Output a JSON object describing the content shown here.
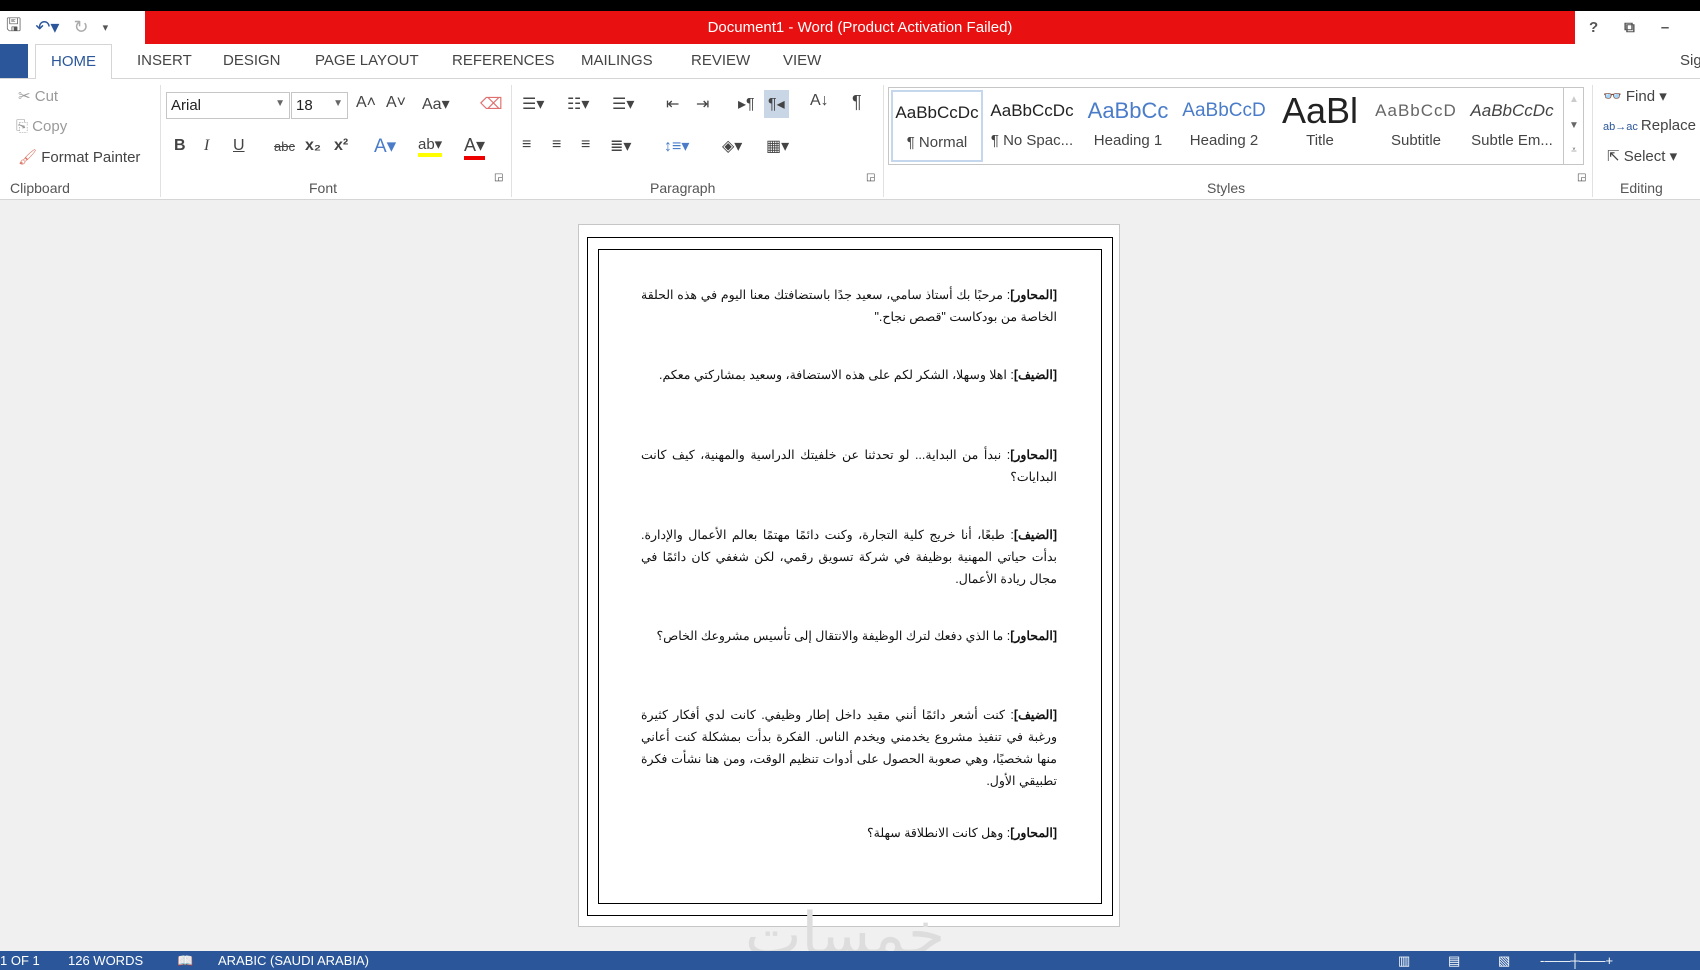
{
  "title": "Document1 -  Word (Product Activation Failed)",
  "window_controls": {
    "help": "?",
    "restore": "⧉",
    "minimize": "–"
  },
  "tabs": [
    "HOME",
    "INSERT",
    "DESIGN",
    "PAGE LAYOUT",
    "REFERENCES",
    "MAILINGS",
    "REVIEW",
    "VIEW"
  ],
  "sign_in": "Sig",
  "clipboard": {
    "cut": "Cut",
    "copy": "Copy",
    "format_painter": "Format Painter",
    "label": "Clipboard"
  },
  "font": {
    "name": "Arial",
    "size": "18",
    "label": "Font",
    "bold": "B",
    "italic": "I",
    "underline": "U",
    "strike": "abc",
    "sub": "x₂",
    "sup": "x²",
    "change_case": "Aa"
  },
  "paragraph": {
    "label": "Paragraph"
  },
  "styles": {
    "label": "Styles",
    "items": [
      {
        "preview": "AaBbCcDc",
        "name": "¶ Normal"
      },
      {
        "preview": "AaBbCcDc",
        "name": "¶ No Spac..."
      },
      {
        "preview": "AaBbCc",
        "name": "Heading 1"
      },
      {
        "preview": "AaBbCcD",
        "name": "Heading 2"
      },
      {
        "preview": "AaBl",
        "name": "Title"
      },
      {
        "preview": "AaBbCcD",
        "name": "Subtitle"
      },
      {
        "preview": "AaBbCcDc",
        "name": "Subtle Em..."
      }
    ]
  },
  "editing": {
    "find": "Find",
    "replace": "Replace",
    "select": "Select",
    "label": "Editing"
  },
  "document": {
    "paragraphs": [
      {
        "speaker": "[المحاور]",
        "text": ": مرحبًا بك أستاذ سامي، سعيد جدًا باستضافتك معنا اليوم في هذه الحلقة الخاصة من بودكاست \"قصص نجاح.\""
      },
      {
        "speaker": "[الضيف]",
        "text": ": اهلا وسهلا، الشكر لكم على هذه الاستضافة، وسعيد بمشاركتي معكم."
      },
      {
        "speaker": "[المحاور]",
        "text": ": نبدأ من البداية... لو تحدثنا عن خلفيتك الدراسية والمهنية، كيف كانت البدايات؟"
      },
      {
        "speaker": "[الضيف]",
        "text": ": طبعًا، أنا خريج كلية التجارة، وكنت دائمًا مهتمًا بعالم الأعمال والإدارة. بدأت حياتي المهنية بوظيفة في شركة تسويق رقمي، لكن شغفي كان دائمًا في مجال ريادة الأعمال."
      },
      {
        "speaker": "[المحاور]",
        "text": ": ما الذي دفعك لترك الوظيفة والانتقال إلى تأسيس مشروعك الخاص؟"
      },
      {
        "speaker": "[الضيف]",
        "text": ": كنت أشعر دائمًا أنني مقيد داخل إطار وظيفي. كانت لدي أفكار كثيرة ورغبة في تنفيذ مشروع يخدمني ويخدم الناس. الفكرة بدأت بمشكلة كنت أعاني منها شخصيًا، وهي صعوبة الحصول على أدوات تنظيم الوقت، ومن هنا نشأت فكرة تطبيقي الأول."
      },
      {
        "speaker": "[المحاور]",
        "text": ": وهل كانت الانطلاقة سهلة؟"
      }
    ]
  },
  "watermark": "خمسات",
  "status": {
    "page": "1 OF 1",
    "words": "126 WORDS",
    "language": "ARABIC (SAUDI ARABIA)"
  },
  "colors": {
    "title_bar": "#e81010",
    "accent": "#2b579a"
  }
}
